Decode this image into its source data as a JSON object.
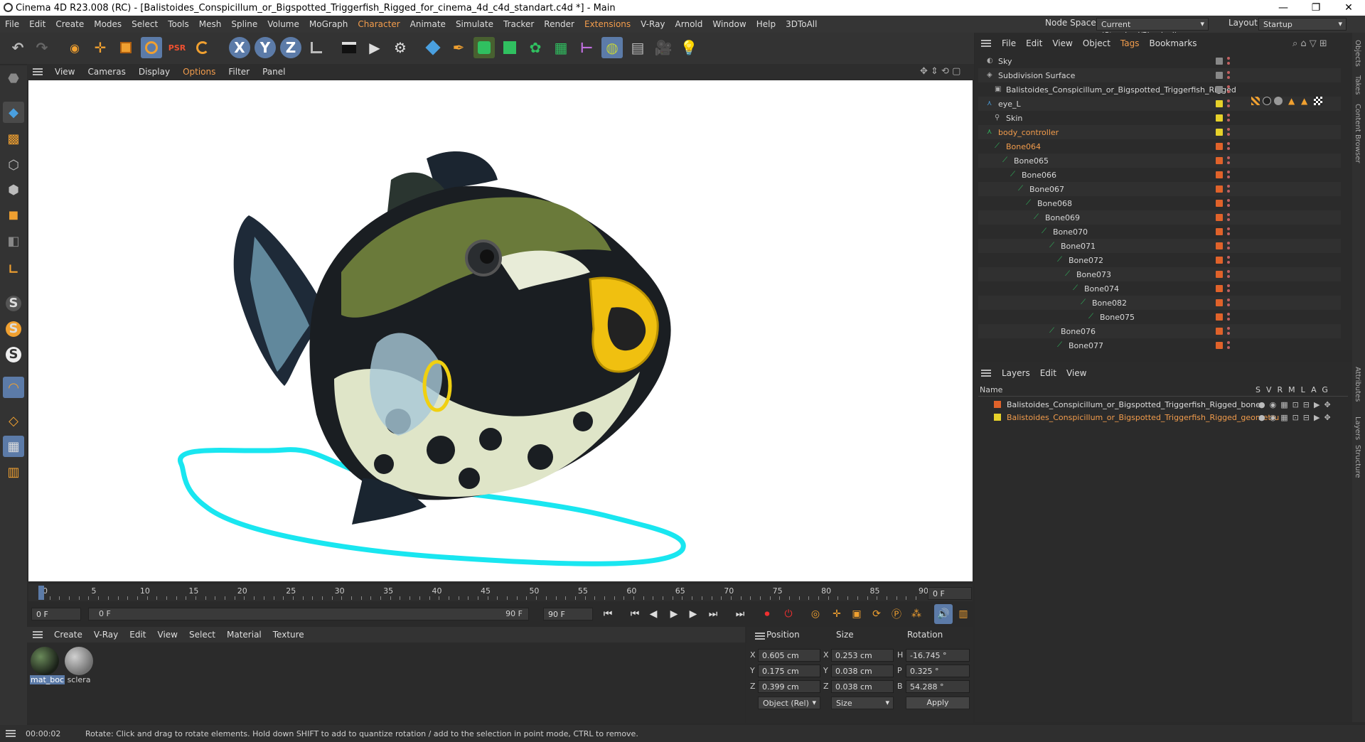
{
  "window": {
    "title": "Cinema 4D R23.008 (RC) - [Balistoides_Conspicillum_or_Bigspotted_Triggerfish_Rigged_for_cinema_4d_c4d_standart.c4d *] - Main",
    "minimize": "—",
    "maximize": "❐",
    "close": "✕"
  },
  "menubar": {
    "items": [
      "File",
      "Edit",
      "Create",
      "Modes",
      "Select",
      "Tools",
      "Mesh",
      "Spline",
      "Volume",
      "MoGraph",
      "Character",
      "Animate",
      "Simulate",
      "Tracker",
      "Render",
      "Extensions",
      "V-Ray",
      "Arnold",
      "Window",
      "Help",
      "3DToAll"
    ],
    "node_space_label": "Node Space:",
    "node_space_value": "Current (Standard/Physical)",
    "layout_label": "Layout:",
    "layout_value": "Startup"
  },
  "toolbar": {
    "undo": "↶",
    "redo": "↷",
    "move": "✛",
    "x": "X",
    "y": "Y",
    "z": "Z",
    "light": "💡"
  },
  "viewport_menu": {
    "items": [
      "View",
      "Cameras",
      "Display",
      "Options",
      "Filter",
      "Panel"
    ]
  },
  "timeline": {
    "ticks": [
      "0",
      "5",
      "10",
      "15",
      "20",
      "25",
      "30",
      "35",
      "40",
      "45",
      "50",
      "55",
      "60",
      "65",
      "70",
      "75",
      "80",
      "85",
      "90"
    ],
    "current_frame": "0 F",
    "start_frame": "0 F",
    "range_start": "0 F",
    "range_end": "90 F",
    "end_frame": "90 F",
    "playhead_fraction": 0
  },
  "material_menu": {
    "items": [
      "Create",
      "V-Ray",
      "Edit",
      "View",
      "Select",
      "Material",
      "Texture"
    ]
  },
  "materials": [
    {
      "name": "mat_boc"
    },
    {
      "name": "sclera"
    }
  ],
  "attributes": {
    "position_label": "Position",
    "size_label": "Size",
    "rotation_label": "Rotation",
    "pos": {
      "x": "0.605 cm",
      "y": "0.175 cm",
      "z": "0.399 cm"
    },
    "size": {
      "x": "0.253 cm",
      "y": "0.038 cm",
      "z": "0.038 cm"
    },
    "rot": {
      "h": "-16.745 °",
      "p": "0.325 °",
      "b": "54.288 °"
    },
    "axis_labels": {
      "x": "X",
      "y": "Y",
      "z": "Z",
      "h": "H",
      "p": "P",
      "b": "B"
    },
    "coord_mode": "Object (Rel)",
    "size_mode": "Size",
    "apply": "Apply"
  },
  "status": {
    "time": "00:00:02",
    "message": "Rotate: Click and drag to rotate elements. Hold down SHIFT to add to quantize rotation / add to the selection in point mode, CTRL to remove."
  },
  "object_menu": {
    "items": [
      "File",
      "Edit",
      "View",
      "Object",
      "Tags",
      "Bookmarks"
    ]
  },
  "objects": [
    {
      "name": "Sky",
      "indent": 0,
      "tag": "#888888",
      "hl": false
    },
    {
      "name": "Subdivision Surface",
      "indent": 0,
      "tag": "#888888",
      "hl": false
    },
    {
      "name": "Balistoides_Conspicillum_or_Bigspotted_Triggerfish_Rigged",
      "indent": 1,
      "tag": "#888888",
      "hl": false
    },
    {
      "name": "eye_L",
      "indent": 0,
      "tag": "#e6d12a",
      "hl": false
    },
    {
      "name": "Skin",
      "indent": 1,
      "tag": "#e6d12a",
      "hl": false
    },
    {
      "name": "body_controller",
      "indent": 0,
      "tag": "#e6d12a",
      "hl": true
    },
    {
      "name": "Bone064",
      "indent": 1,
      "tag": "#e0622a",
      "hl": true
    },
    {
      "name": "Bone065",
      "indent": 2,
      "tag": "#e0622a",
      "hl": false
    },
    {
      "name": "Bone066",
      "indent": 3,
      "tag": "#e0622a",
      "hl": false
    },
    {
      "name": "Bone067",
      "indent": 4,
      "tag": "#e0622a",
      "hl": false
    },
    {
      "name": "Bone068",
      "indent": 5,
      "tag": "#e0622a",
      "hl": false
    },
    {
      "name": "Bone069",
      "indent": 6,
      "tag": "#e0622a",
      "hl": false
    },
    {
      "name": "Bone070",
      "indent": 7,
      "tag": "#e0622a",
      "hl": false
    },
    {
      "name": "Bone071",
      "indent": 8,
      "tag": "#e0622a",
      "hl": false
    },
    {
      "name": "Bone072",
      "indent": 9,
      "tag": "#e0622a",
      "hl": false
    },
    {
      "name": "Bone073",
      "indent": 10,
      "tag": "#e0622a",
      "hl": false
    },
    {
      "name": "Bone074",
      "indent": 11,
      "tag": "#e0622a",
      "hl": false
    },
    {
      "name": "Bone082",
      "indent": 12,
      "tag": "#e0622a",
      "hl": false
    },
    {
      "name": "Bone075",
      "indent": 13,
      "tag": "#e0622a",
      "hl": false
    },
    {
      "name": "Bone076",
      "indent": 8,
      "tag": "#e0622a",
      "hl": false
    },
    {
      "name": "Bone077",
      "indent": 9,
      "tag": "#e0622a",
      "hl": false
    }
  ],
  "layer_menu": {
    "items": [
      "Layers",
      "Edit",
      "View"
    ]
  },
  "layers": {
    "name_header": "Name",
    "flags": [
      "S",
      "V",
      "R",
      "M",
      "L",
      "A",
      "G"
    ],
    "rows": [
      {
        "name": "Balistoides_Conspicillum_or_Bigspotted_Triggerfish_Rigged_bones",
        "color": "#e0622a",
        "hl": false
      },
      {
        "name": "Balistoides_Conspicillum_or_Bigspotted_Triggerfish_Rigged_geometru",
        "color": "#e6d12a",
        "hl": true
      }
    ]
  },
  "side_tabs": [
    "Objects",
    "Takes",
    "Content Browser",
    "Attributes",
    "Layers",
    "Structure"
  ],
  "colors": {
    "accent": "#f29c4c",
    "active_tool": "#5c7ba8",
    "spline": "#19e6f0"
  }
}
